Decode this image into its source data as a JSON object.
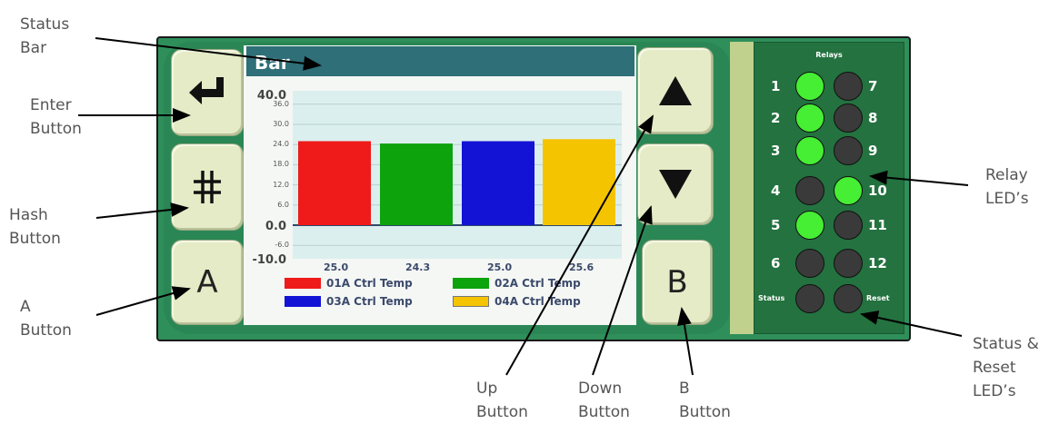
{
  "annotations": {
    "status_bar": [
      "Status",
      "Bar"
    ],
    "enter_button": [
      "Enter",
      "Button"
    ],
    "hash_button": [
      "Hash",
      "Button"
    ],
    "a_button": [
      "A",
      "Button"
    ],
    "up_button": [
      "Up",
      "Button"
    ],
    "down_button": [
      "Down",
      "Button"
    ],
    "b_button": [
      "B",
      "Button"
    ],
    "relay_leds": [
      "Relay",
      "LED’s"
    ],
    "status_reset_leds": [
      "Status &",
      "Reset",
      "LED’s"
    ]
  },
  "buttons": {
    "enter_icon": "enter-arrow-icon",
    "hash_symbol": "#",
    "a_label": "A",
    "b_label": "B",
    "up_icon": "triangle-up-icon",
    "down_icon": "triangle-down-icon"
  },
  "screen": {
    "status_bar_title": "Bar"
  },
  "chart_data": {
    "type": "bar",
    "categories": [
      "01A Ctrl Temp",
      "02A Ctrl Temp",
      "03A Ctrl Temp",
      "04A Ctrl Temp"
    ],
    "values": [
      25.0,
      24.3,
      25.0,
      25.6
    ],
    "value_labels": [
      "25.0",
      "24.3",
      "25.0",
      "25.6"
    ],
    "colors": [
      "#ef1a1a",
      "#0ca30c",
      "#1313d6",
      "#f5c400"
    ],
    "ylim": [
      -10.0,
      40.0
    ],
    "y_ticks_major": [
      "40.0",
      "0.0",
      "-10.0"
    ],
    "y_ticks_minor": [
      "36.0",
      "30.0",
      "24.0",
      "18.0",
      "12.0",
      "6.0",
      "-6.0"
    ],
    "y_tick_values_minor": [
      36,
      30,
      24,
      18,
      12,
      6,
      -6
    ],
    "grid": true,
    "legend_position": "bottom",
    "title": "",
    "xlabel": "",
    "ylabel": ""
  },
  "relays": {
    "title": "Relays",
    "left": [
      {
        "num": "1",
        "on": true
      },
      {
        "num": "2",
        "on": true
      },
      {
        "num": "3",
        "on": true
      },
      {
        "num": "4",
        "on": false
      },
      {
        "num": "5",
        "on": true
      },
      {
        "num": "6",
        "on": false
      }
    ],
    "right": [
      {
        "num": "7",
        "on": false
      },
      {
        "num": "8",
        "on": false
      },
      {
        "num": "9",
        "on": false
      },
      {
        "num": "10",
        "on": true
      },
      {
        "num": "11",
        "on": false
      },
      {
        "num": "12",
        "on": false
      }
    ],
    "status_label": "Status",
    "reset_label": "Reset",
    "status_on": false,
    "reset_on": false
  },
  "colors": {
    "device_green": "#2f8f5a",
    "status_bar_teal": "#2e6f78",
    "led_on": "#46ee34",
    "led_off": "#3a3a3a"
  }
}
